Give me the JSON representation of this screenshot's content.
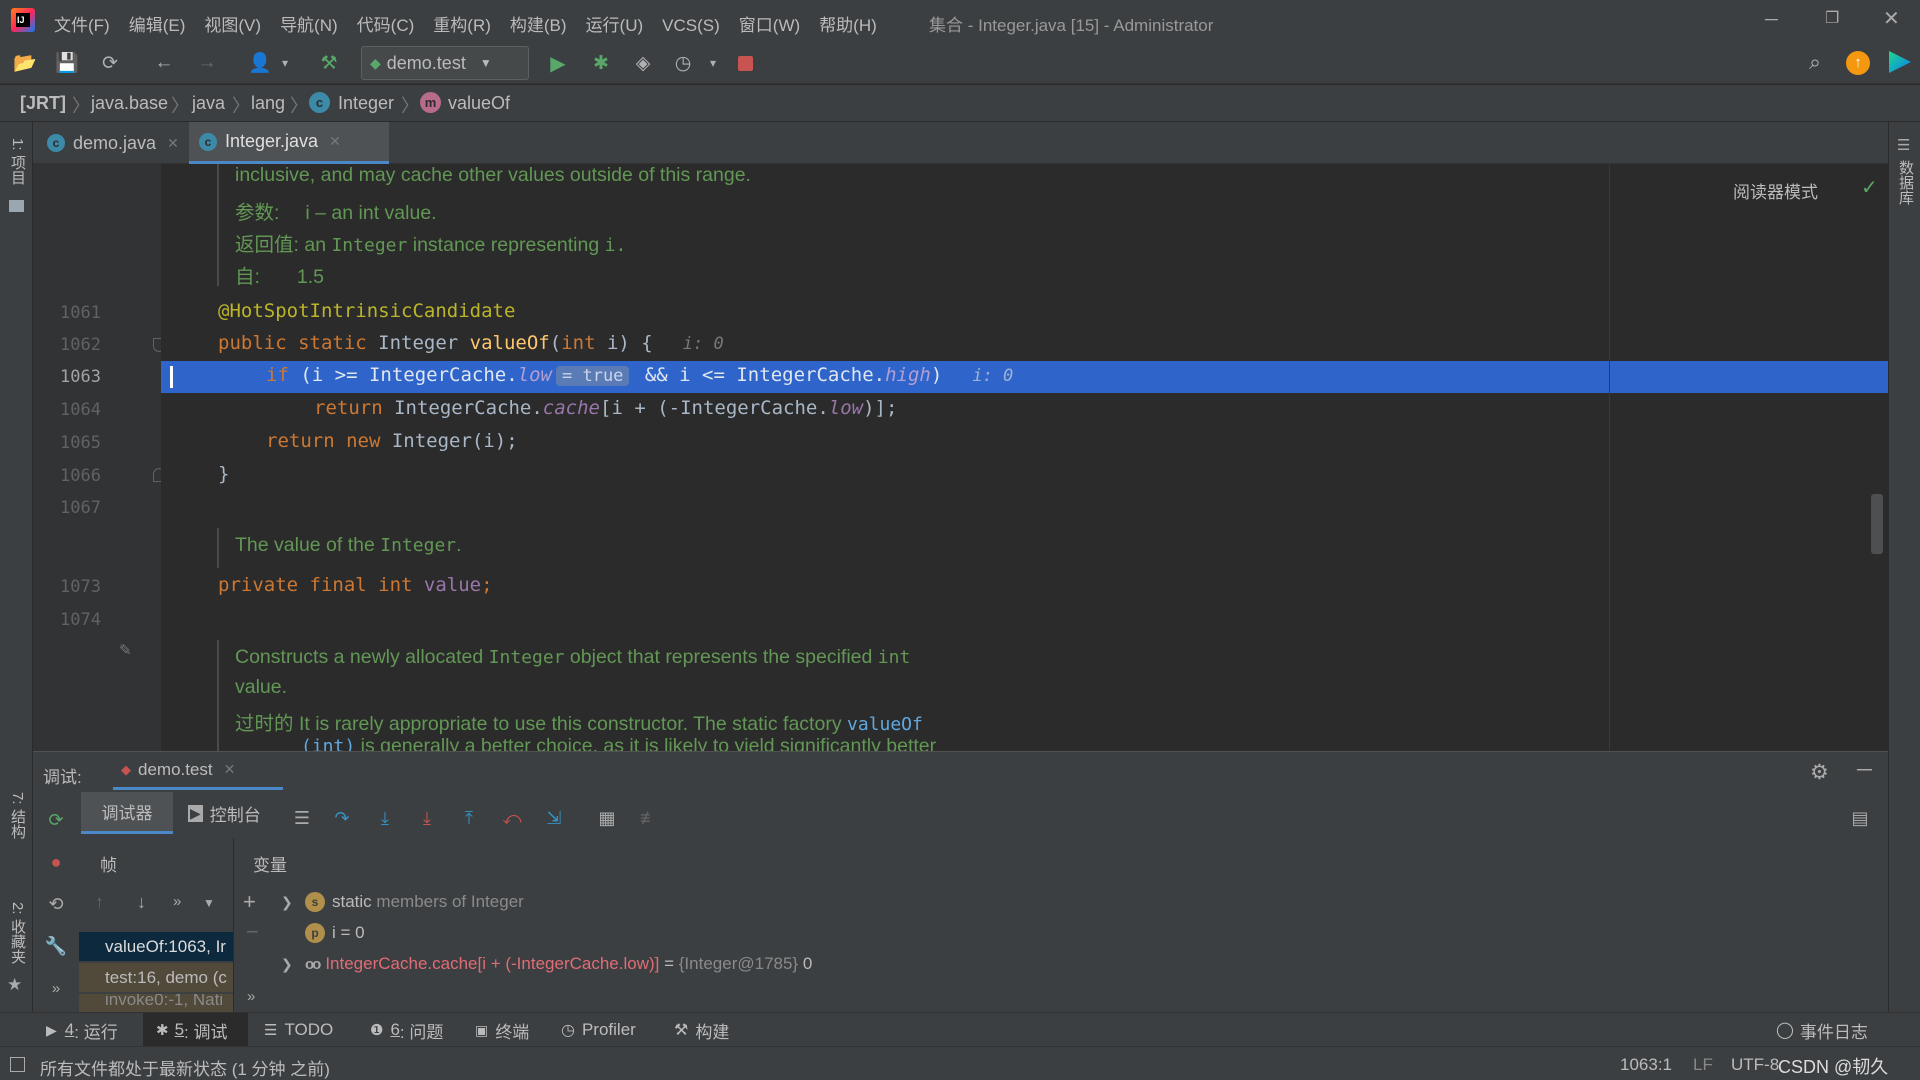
{
  "window": {
    "title": "集合 - Integer.java [15] - Administrator",
    "menu": [
      "文件(F)",
      "编辑(E)",
      "视图(V)",
      "导航(N)",
      "代码(C)",
      "重构(R)",
      "构建(B)",
      "运行(U)",
      "VCS(S)",
      "窗口(W)",
      "帮助(H)"
    ]
  },
  "toolbar": {
    "run_config": "demo.test"
  },
  "breadcrumbs": [
    "[JRT]",
    "java.base",
    "java",
    "lang",
    "Integer",
    "valueOf"
  ],
  "tabs": [
    {
      "label": "demo.java",
      "active": false
    },
    {
      "label": "Integer.java",
      "active": true
    }
  ],
  "side_left": {
    "project": "1: 项目",
    "structure": "7: 结构",
    "favorites": "2: 收藏夹"
  },
  "side_right": {
    "database": "数据库"
  },
  "editor": {
    "reader_mode": "阅读器模式",
    "doc1": {
      "line1": "inclusive, and may cache other values outside of this range.",
      "param_label": "参数:",
      "param_text": "i – an int value.",
      "return_label": "返回值:",
      "return_pre": "an",
      "return_code": "Integer",
      "return_post": "instance representing",
      "return_code2": "i.",
      "since_label": "自:",
      "since_text": "1.5"
    },
    "line_numbers": [
      "1061",
      "1062",
      "1063",
      "1064",
      "1065",
      "1066",
      "1067",
      "1073",
      "1074"
    ],
    "code": {
      "annotation": "@HotSpotIntrinsicCandidate",
      "l1062_kw": "public static",
      "l1062_type": " Integer ",
      "l1062_fn": "valueOf",
      "l1062_params_a": "(",
      "l1062_params_kw": "int",
      "l1062_params_b": " i) {",
      "l1062_hint": "i: 0",
      "l1063_if": "if",
      "l1063_a": " (i >= IntegerCache.",
      "l1063_low": "low",
      "l1063_inline": "= true",
      "l1063_b": " && i <= IntegerCache.",
      "l1063_high": "high",
      "l1063_c": ")",
      "l1063_hint": "i: 0",
      "l1064_ret": "return",
      "l1064_a": " IntegerCache.",
      "l1064_cache": "cache",
      "l1064_b": "[i + (-IntegerCache.",
      "l1064_low": "low",
      "l1064_c": ")];",
      "l1065_ret": "return",
      "l1065_new": " new",
      "l1065_a": " Integer(i);",
      "l1066": "}",
      "l1073_kw": "private final int",
      "l1073_a": " value",
      "l1073_b": ";"
    },
    "doc2": {
      "pre": "The value of the",
      "code": "Integer",
      "post": "."
    },
    "doc3": {
      "l1_pre": "Constructs a newly allocated",
      "l1_code1": "Integer",
      "l1_mid": "object that represents the specified",
      "l1_code2": "int",
      "l2": "value.",
      "l3_label": "过时的",
      "l3_text": "It is rarely appropriate to use this constructor. The static factory",
      "l3_link": "valueOf",
      "l4_code": "(int)",
      "l4_text": "is generally a better choice, as it is likely to yield significantly better"
    }
  },
  "debug": {
    "label": "调试:",
    "session": "demo.test",
    "tab_debugger": "调试器",
    "tab_console": "控制台",
    "frames_header": "帧",
    "vars_header": "变量",
    "frames": [
      "valueOf:1063, Ir",
      "test:16, demo (c",
      "invoke0:-1, Nati"
    ],
    "vars": [
      {
        "badge": "s",
        "name": "static",
        "text": " members of Integer"
      },
      {
        "badge": "p",
        "name": "i",
        "text": " = 0"
      },
      {
        "badge": "oo",
        "name": "IntegerCache.cache[i + (-IntegerCache.low)]",
        "eq": " = ",
        "type": "{Integer@1785}",
        "val": " 0"
      }
    ]
  },
  "bottom_tools": [
    {
      "num": "4",
      "label": ": 运行"
    },
    {
      "num": "5",
      "label": ": 调试"
    },
    {
      "num": "",
      "label": "TODO"
    },
    {
      "num": "6",
      "label": ": 问题"
    },
    {
      "num": "",
      "label": "终端"
    },
    {
      "num": "",
      "label": "Profiler"
    },
    {
      "num": "",
      "label": "构建"
    }
  ],
  "event_log": "事件日志",
  "status": {
    "message": "所有文件都处于最新状态 (1 分钟 之前)",
    "position": "1063:1",
    "line_sep": "LF",
    "encoding": "UTF-8",
    "watermark": "CSDN @韧久",
    "colors": {
      "selection": "#2f65ca",
      "keyword": "#cc7832",
      "doc": "#629755",
      "annotation": "#bbb529"
    }
  }
}
